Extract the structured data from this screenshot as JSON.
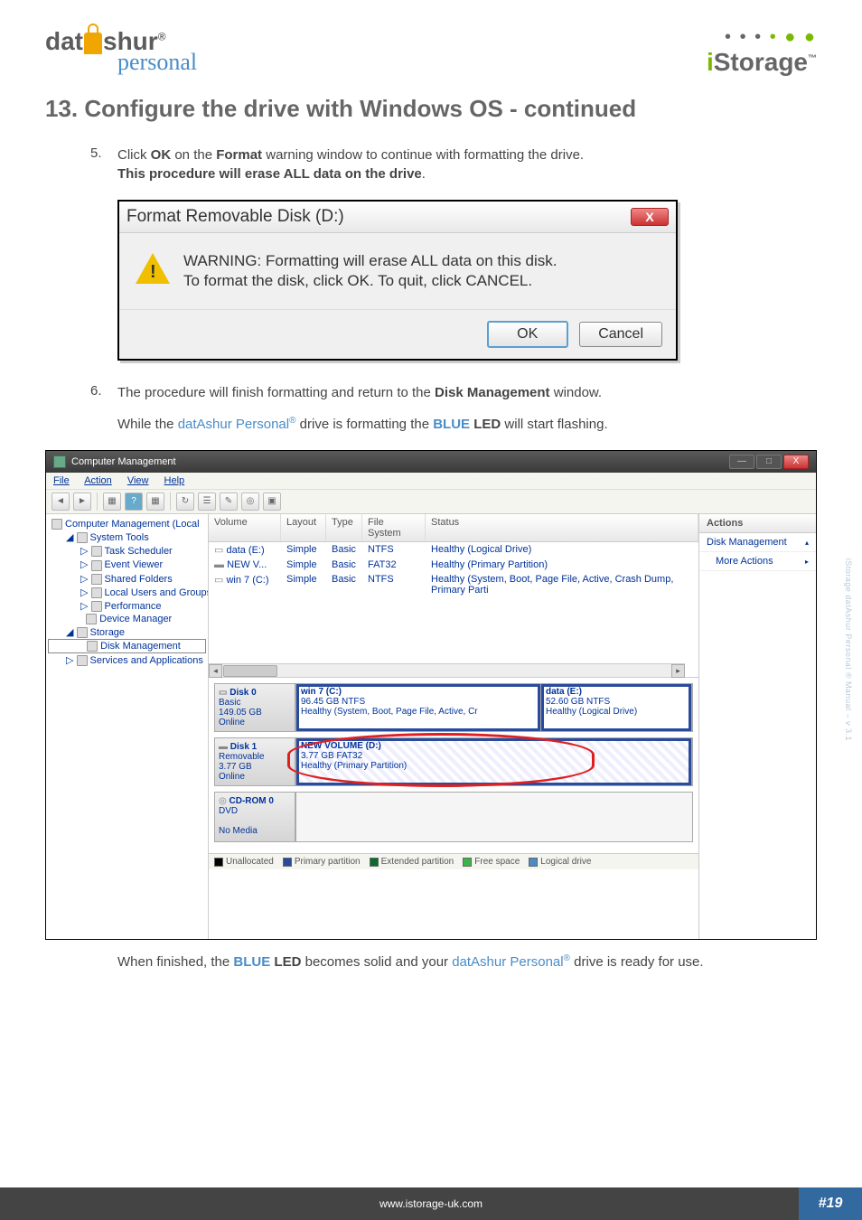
{
  "header": {
    "brand_left_1": "dat",
    "brand_left_2": "shur",
    "brand_reg": "®",
    "brand_sub": "personal",
    "brand_right_i": "i",
    "brand_right_rest": "Storage",
    "brand_right_tm": "™"
  },
  "section_title": "13. Configure the drive with Windows OS - continued",
  "steps": {
    "s5_num": "5.",
    "s5_a": "Click ",
    "s5_ok": "OK",
    "s5_b": " on the ",
    "s5_fmt": "Format",
    "s5_c": " warning window to continue with formatting the drive.",
    "s5_line2": "This procedure will erase ALL data on the drive",
    "s5_dot": ".",
    "s6_num": "6.",
    "s6_a": "The procedure will finish formatting and return to the ",
    "s6_dm": "Disk Management",
    "s6_b": " window.",
    "s6_sub_a": "While the ",
    "s6_prod": "datAshur Personal",
    "s6_reg": "®",
    "s6_sub_b": " drive is formatting the ",
    "s6_blue": "BLUE",
    "s6_led": " LED",
    "s6_sub_c": " will start flashing."
  },
  "dialog": {
    "title": "Format Removable Disk (D:)",
    "close": "X",
    "msg1": "WARNING: Formatting will erase ALL data on this disk.",
    "msg2": "To format the disk, click OK. To quit, click CANCEL.",
    "ok": "OK",
    "cancel": "Cancel"
  },
  "dm": {
    "title": "Computer Management",
    "menu": {
      "file": "File",
      "action": "Action",
      "view": "View",
      "help": "Help"
    },
    "tree": {
      "root": "Computer Management (Local",
      "systools": "System Tools",
      "task": "Task Scheduler",
      "event": "Event Viewer",
      "shared": "Shared Folders",
      "users": "Local Users and Groups",
      "perf": "Performance",
      "devmgr": "Device Manager",
      "storage": "Storage",
      "diskmgmt": "Disk Management",
      "services": "Services and Applications"
    },
    "cols": {
      "volume": "Volume",
      "layout": "Layout",
      "type": "Type",
      "fs": "File System",
      "status": "Status"
    },
    "rows": [
      {
        "vol": "data (E:)",
        "layout": "Simple",
        "type": "Basic",
        "fs": "NTFS",
        "status": "Healthy (Logical Drive)"
      },
      {
        "vol": "NEW V...",
        "layout": "Simple",
        "type": "Basic",
        "fs": "FAT32",
        "status": "Healthy (Primary Partition)"
      },
      {
        "vol": "win 7 (C:)",
        "layout": "Simple",
        "type": "Basic",
        "fs": "NTFS",
        "status": "Healthy (System, Boot, Page File, Active, Crash Dump, Primary Parti"
      }
    ],
    "disk0": {
      "name": "Disk 0",
      "type": "Basic",
      "size": "149.05 GB",
      "state": "Online",
      "p1_name": "win 7  (C:)",
      "p1_size": "96.45 GB NTFS",
      "p1_stat": "Healthy (System, Boot, Page File, Active, Cr",
      "p2_name": "data  (E:)",
      "p2_size": "52.60 GB NTFS",
      "p2_stat": "Healthy (Logical Drive)"
    },
    "disk1": {
      "name": "Disk 1",
      "type": "Removable",
      "size": "3.77 GB",
      "state": "Online",
      "p1_name": "NEW VOLUME  (D:)",
      "p1_size": "3.77 GB FAT32",
      "p1_stat": "Healthy (Primary Partition)"
    },
    "cdrom": {
      "name": "CD-ROM 0",
      "type": "DVD",
      "nomedia": "No Media"
    },
    "legend": {
      "unalloc": "Unallocated",
      "primary": "Primary partition",
      "ext": "Extended partition",
      "free": "Free space",
      "logical": "Logical drive"
    },
    "actions": {
      "header": "Actions",
      "item1": "Disk Management",
      "item2": "More Actions"
    }
  },
  "final": {
    "a": "When finished, the ",
    "blue": "BLUE",
    "led": " LED",
    "b": " becomes solid and your ",
    "prod": "datAshur Personal",
    "reg": "®",
    "c": " drive is ready for use."
  },
  "side_text": "iStorage datAshur Personal ® Manual – v 3.1",
  "footer": {
    "url": "www.istorage-uk.com",
    "page": "#19"
  }
}
